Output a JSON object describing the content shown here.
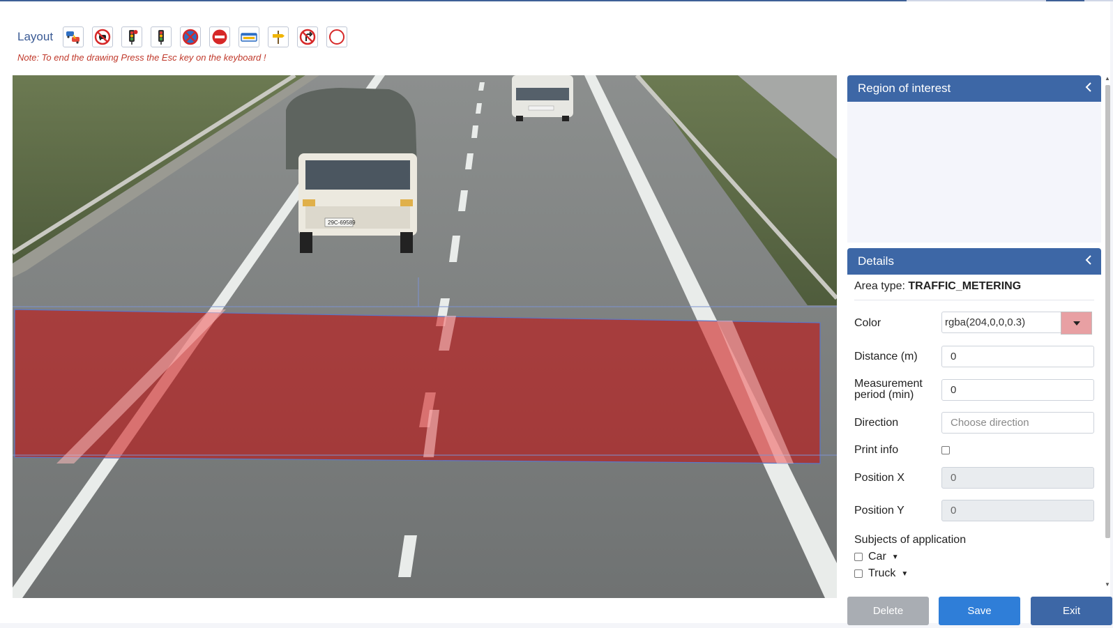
{
  "header": {
    "layout_label": "Layout",
    "note": "Note: To end the drawing Press the Esc key on the keyboard !",
    "tools": [
      {
        "icon": "vehicle-collision-icon"
      },
      {
        "icon": "no-car-icon"
      },
      {
        "icon": "traffic-light-red-icon"
      },
      {
        "icon": "traffic-light-green-icon"
      },
      {
        "icon": "no-stopping-icon"
      },
      {
        "icon": "no-entry-icon"
      },
      {
        "icon": "license-plate-icon"
      },
      {
        "icon": "direction-sign-icon"
      },
      {
        "icon": "no-turn-icon"
      },
      {
        "icon": "circle-zone-icon"
      }
    ]
  },
  "canvas": {
    "roi_fill_color": "rgba(204,0,0,0.3)",
    "truck_plate": "29C-69589"
  },
  "roi_panel": {
    "title": "Region of interest"
  },
  "details": {
    "title": "Details",
    "area_type_label": "Area type:",
    "area_type_value": "TRAFFIC_METERING",
    "color_label": "Color",
    "color_value": "rgba(204,0,0,0.3)",
    "color_swatch": "#e8a0a3",
    "distance_label": "Distance (m)",
    "distance_value": "0",
    "measurement_label_1": "Measurement",
    "measurement_label_2": "period (min)",
    "measurement_value": "0",
    "direction_label": "Direction",
    "direction_placeholder": "Choose direction",
    "print_info_label": "Print info",
    "print_info_checked": false,
    "position_x_label": "Position X",
    "position_x_value": "0",
    "position_y_label": "Position Y",
    "position_y_value": "0",
    "subjects_title": "Subjects of application",
    "subjects": [
      {
        "label": "Car",
        "checked": false
      },
      {
        "label": "Truck",
        "checked": false
      }
    ]
  },
  "actions": {
    "delete_label": "Delete",
    "save_label": "Save",
    "exit_label": "Exit"
  },
  "colors": {
    "primary": "#3d67a6",
    "save": "#2f7ed8",
    "disabled": "#a9adb3",
    "note": "#c0392b"
  }
}
